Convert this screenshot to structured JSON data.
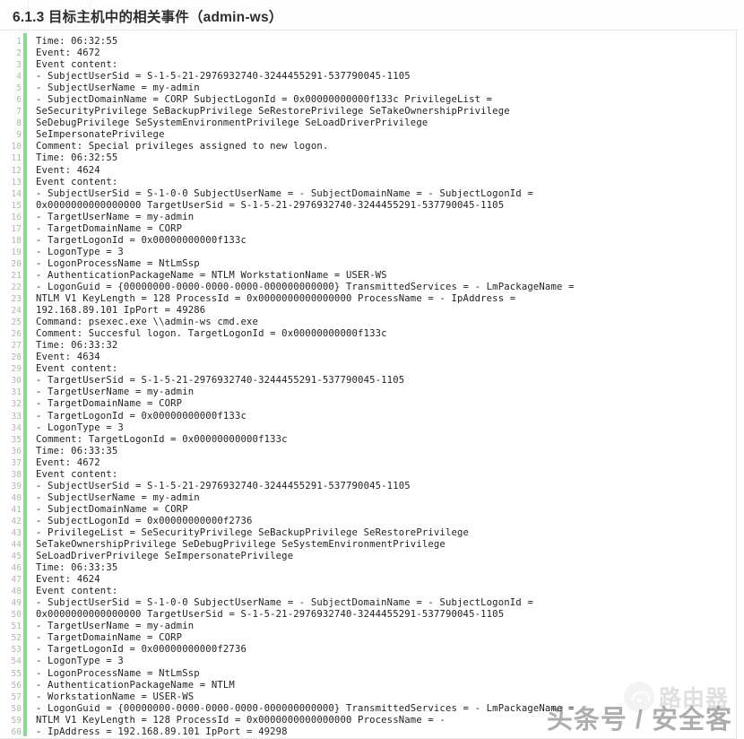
{
  "header": {
    "section_number": "6.1.3",
    "title": "6.1.3 目标主机中的相关事件（admin-ws）"
  },
  "code_block": {
    "gutter_accent_color": "#85de89",
    "line_number_color": "#b3b3b3",
    "text_color": "#1f1f1f",
    "total_lines": 60,
    "lines": [
      "Time: 06:32:55",
      "Event: 4672",
      "Event content:",
      "- SubjectUserSid = S-1-5-21-2976932740-3244455291-537790045-1105",
      "- SubjectUserName = my-admin",
      "- SubjectDomainName = CORP SubjectLogonId = 0x00000000000f133c PrivilegeList =",
      "SeSecurityPrivilege SeBackupPrivilege SeRestorePrivilege SeTakeOwnershipPrivilege",
      "SeDebugPrivilege SeSystemEnvironmentPrivilege SeLoadDriverPrivilege",
      "SeImpersonatePrivilege",
      "Comment: Special privileges assigned to new logon.",
      "Time: 06:32:55",
      "Event: 4624",
      "Event content:",
      "- SubjectUserSid = S-1-0-0 SubjectUserName = - SubjectDomainName = - SubjectLogonId =",
      "0x0000000000000000 TargetUserSid = S-1-5-21-2976932740-3244455291-537790045-1105",
      "- TargetUserName = my-admin",
      "- TargetDomainName = CORP",
      "- TargetLogonId = 0x00000000000f133c",
      "- LogonType = 3",
      "- LogonProcessName = NtLmSsp",
      "- AuthenticationPackageName = NTLM WorkstationName = USER-WS",
      "- LogonGuid = {00000000-0000-0000-0000-000000000000} TransmittedServices = - LmPackageName =",
      "NTLM V1 KeyLength = 128 ProcessId = 0x0000000000000000 ProcessName = - IpAddress =",
      "192.168.89.101 IpPort = 49286",
      "Command: psexec.exe \\\\admin-ws cmd.exe",
      "Comment: Succesful logon. TargetLogonId = 0x00000000000f133c",
      "Time: 06:33:32",
      "Event: 4634",
      "Event content:",
      "- TargetUserSid = S-1-5-21-2976932740-3244455291-537790045-1105",
      "- TargetUserName = my-admin",
      "- TargetDomainName = CORP",
      "- TargetLogonId = 0x00000000000f133c",
      "- LogonType = 3",
      "Comment: TargetLogonId = 0x00000000000f133c",
      "Time: 06:33:35",
      "Event: 4672",
      "Event content:",
      "- SubjectUserSid = S-1-5-21-2976932740-3244455291-537790045-1105",
      "- SubjectUserName = my-admin",
      "- SubjectDomainName = CORP",
      "- SubjectLogonId = 0x00000000000f2736",
      "- PrivilegeList = SeSecurityPrivilege SeBackupPrivilege SeRestorePrivilege",
      "SeTakeOwnershipPrivilege SeDebugPrivilege SeSystemEnvironmentPrivilege",
      "SeLoadDriverPrivilege SeImpersonatePrivilege",
      "Time: 06:33:35",
      "Event: 4624",
      "Event content:",
      "- SubjectUserSid = S-1-0-0 SubjectUserName = - SubjectDomainName = - SubjectLogonId =",
      "0x0000000000000000 TargetUserSid = S-1-5-21-2976932740-3244455291-537790045-1105",
      "- TargetUserName = my-admin",
      "- TargetDomainName = CORP",
      "- TargetLogonId = 0x00000000000f2736",
      "- LogonType = 3",
      "- LogonProcessName = NtLmSsp",
      "- AuthenticationPackageName = NTLM",
      "- WorkstationName = USER-WS",
      "- LogonGuid = {00000000-0000-0000-0000-000000000000} TransmittedServices = - LmPackageName =",
      "NTLM V1 KeyLength = 128 ProcessId = 0x0000000000000000 ProcessName = -",
      "- IpAddress = 192.168.89.101 IpPort = 49298"
    ]
  },
  "watermarks": {
    "primary": "头条号 / 安全客",
    "brand": "路由器"
  }
}
